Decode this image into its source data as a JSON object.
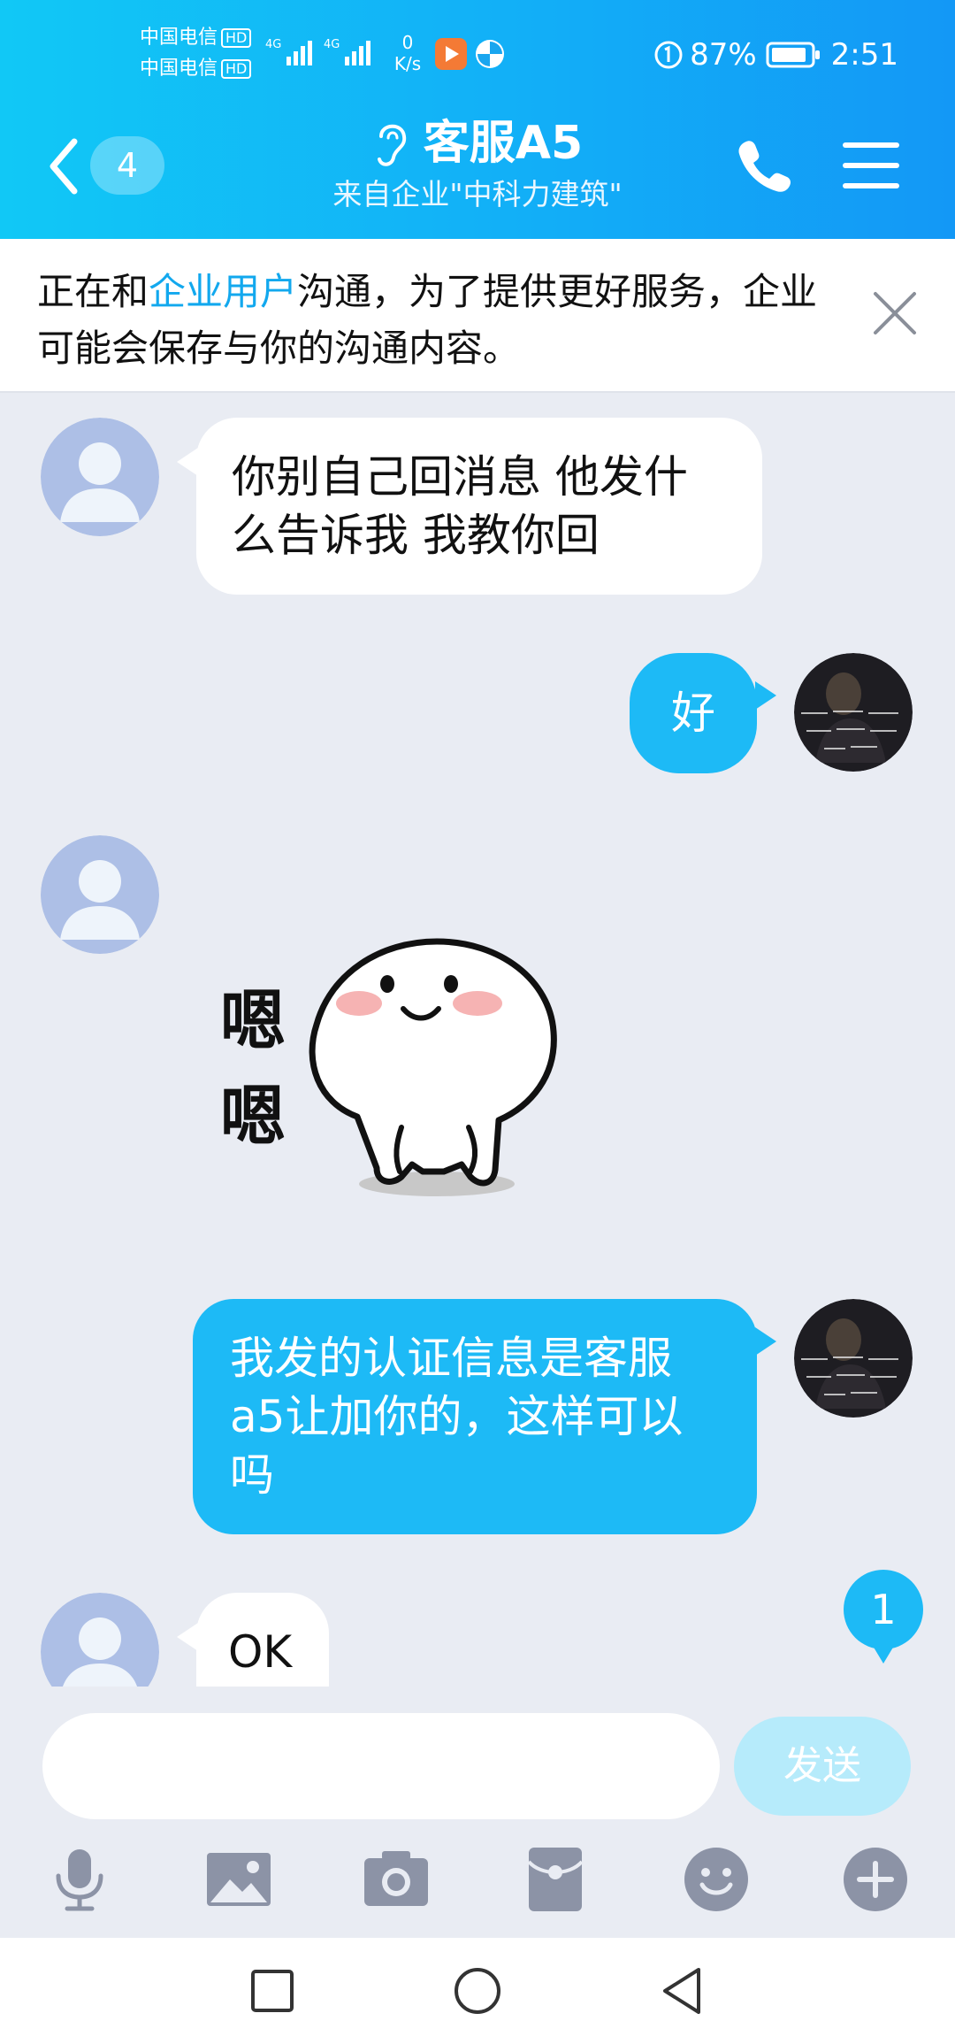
{
  "status_bar": {
    "carrier_1": "中国电信",
    "carrier_2": "中国电信",
    "hd_label": "HD",
    "network_1": "4G",
    "network_2": "4G",
    "net_speed_value": "0",
    "net_speed_unit": "K/s",
    "battery_percent": "87%",
    "time": "2:51"
  },
  "header": {
    "back_count": "4",
    "title": "客服A5",
    "subtitle": "来自企业\"中科力建筑\""
  },
  "notice": {
    "text_before": "正在和",
    "highlight": "企业用户",
    "text_after": "沟通，为了提供更好服务，企业可能会保存与你的沟通内容。"
  },
  "messages": [
    {
      "side": "in",
      "type": "text",
      "text": "你别自己回消息 他发什么告诉我 我教你回"
    },
    {
      "side": "out",
      "type": "text",
      "text": "好"
    },
    {
      "side": "in",
      "type": "sticker",
      "sticker_text": "嗯嗯"
    },
    {
      "side": "out",
      "type": "text",
      "text": "我发的认证信息是客服a5让加你的，这样可以吗"
    },
    {
      "side": "in",
      "type": "text",
      "text": "OK"
    }
  ],
  "unread_count": "1",
  "input": {
    "value": "",
    "send_label": "发送"
  },
  "toolbar": {
    "items": [
      "mic-icon",
      "image-icon",
      "camera-icon",
      "red-packet-icon",
      "emoji-icon",
      "plus-icon"
    ]
  },
  "colors": {
    "header_start": "#11c8f6",
    "header_end": "#1398f6",
    "outgoing_bubble": "#1dbaf6",
    "background": "#e9ecf3",
    "link": "#12a8ee"
  }
}
